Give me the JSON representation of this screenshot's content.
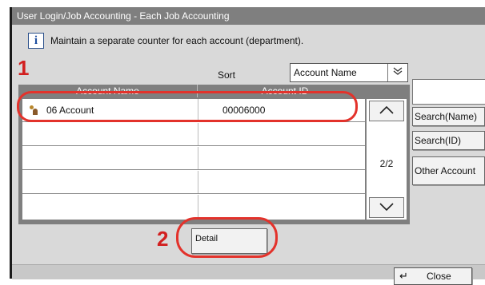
{
  "title": "User Login/Job Accounting - Each Job Accounting",
  "info_message": "Maintain a separate counter for each account (department).",
  "sort": {
    "label": "Sort",
    "value": "Account Name"
  },
  "table": {
    "columns": [
      "Account Name",
      "Account ID"
    ],
    "rows": [
      {
        "name": "06 Account",
        "id": "00006000",
        "icon": "account-icon"
      },
      {
        "name": "",
        "id": ""
      },
      {
        "name": "",
        "id": ""
      },
      {
        "name": "",
        "id": ""
      },
      {
        "name": "",
        "id": ""
      }
    ]
  },
  "pagination": {
    "page": "2/2"
  },
  "side_buttons": {
    "search_name": "Search(Name)",
    "search_id": "Search(ID)",
    "other_account": "Other Account"
  },
  "detail_button": "Detail",
  "close_button": "Close",
  "callouts": [
    "1",
    "2"
  ],
  "colors": {
    "highlight": "#e3322b",
    "callout_text": "#d21f1f",
    "title_bar": "#7f7f7f"
  }
}
